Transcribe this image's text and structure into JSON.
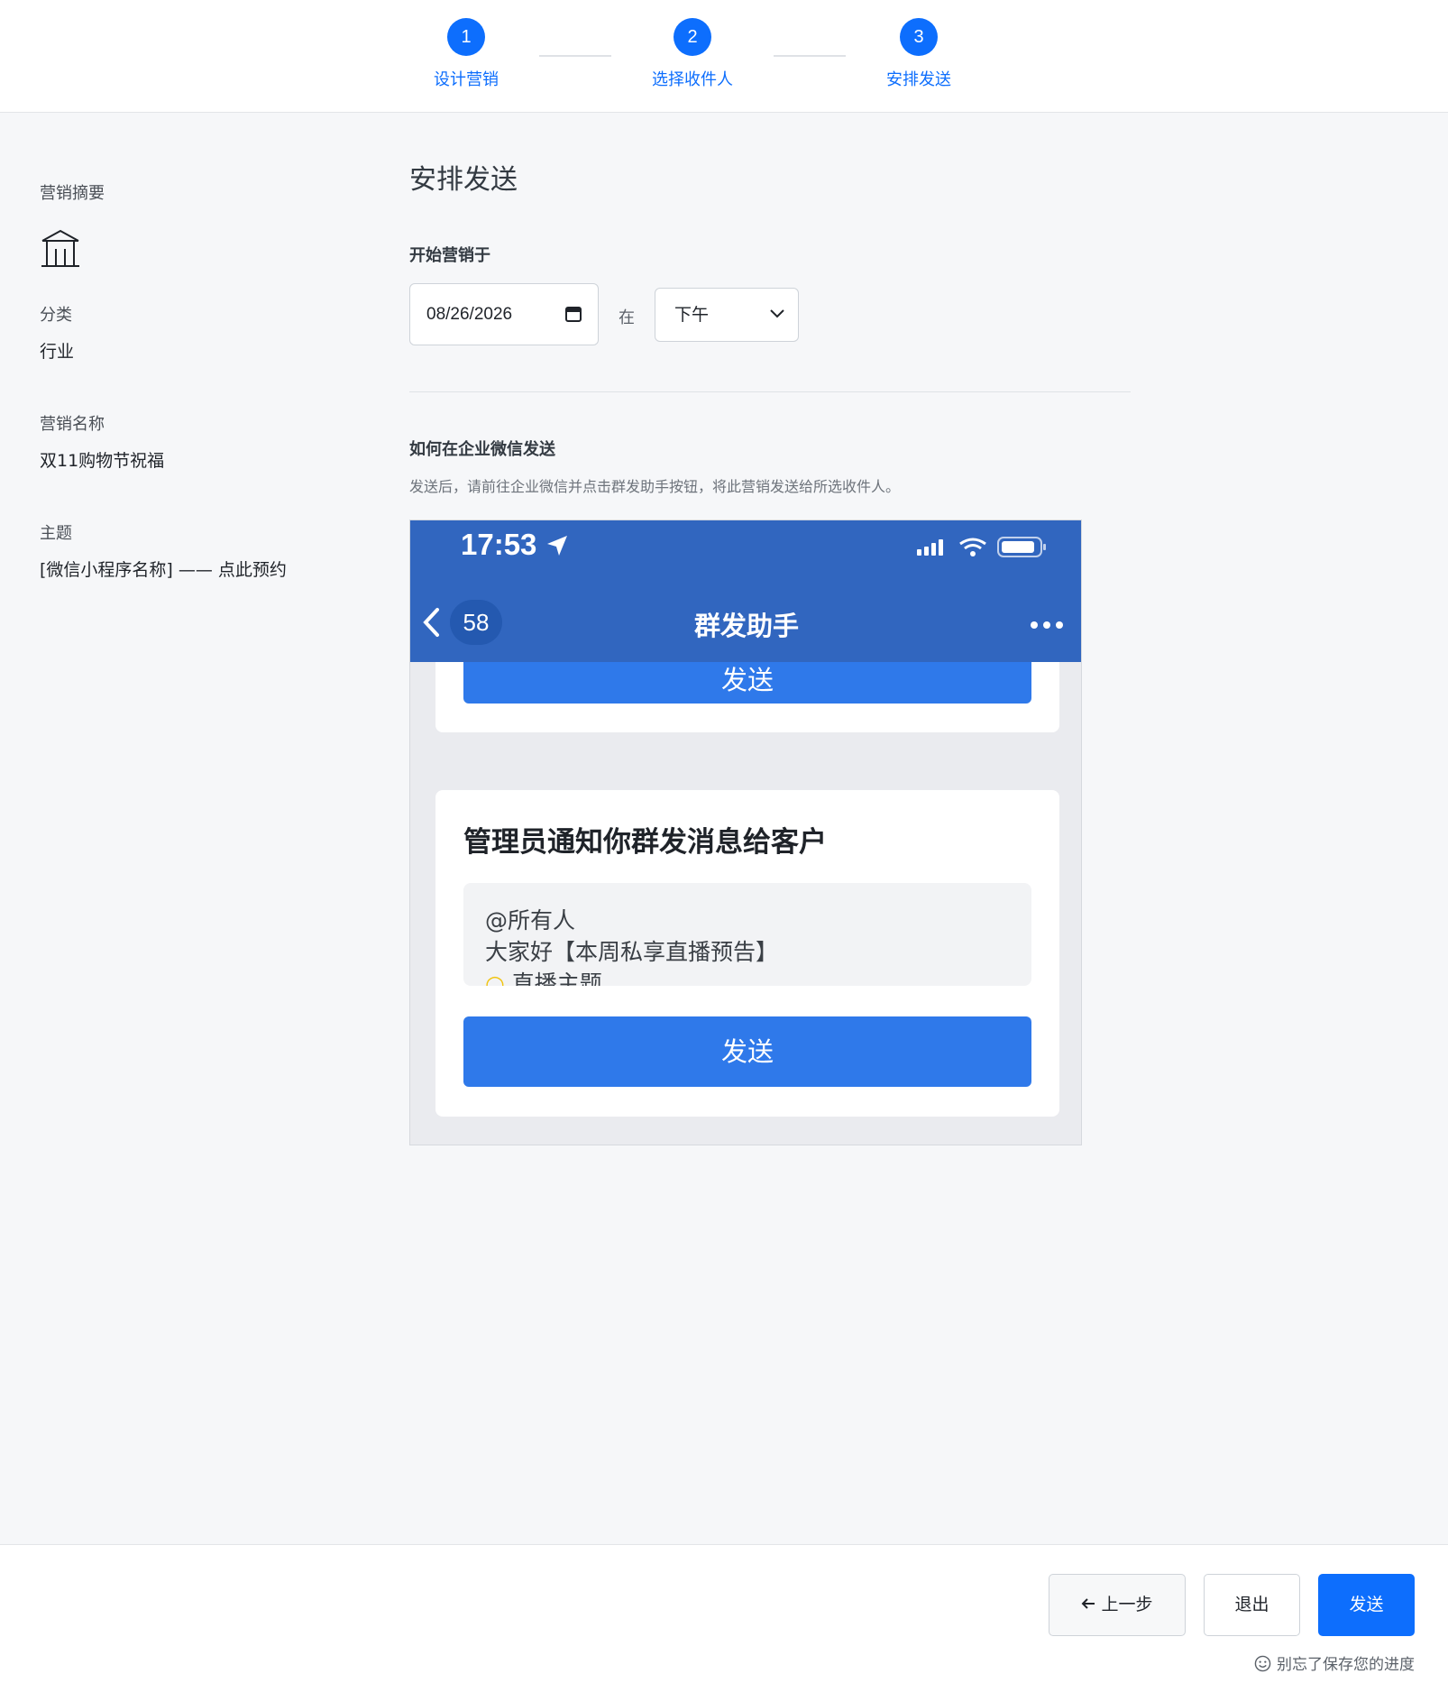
{
  "stepper": {
    "steps": [
      {
        "number": "1",
        "label": "设计营销"
      },
      {
        "number": "2",
        "label": "选择收件人"
      },
      {
        "number": "3",
        "label": "安排发送"
      }
    ]
  },
  "summary": {
    "heading": "营销摘要",
    "icon": "building-icon",
    "category_label": "分类",
    "category_value": "行业",
    "name_label": "营销名称",
    "name_value": "双11购物节祝福",
    "subject_label": "主题",
    "subject_value": "[微信小程序名称] —— 点此预约"
  },
  "schedule": {
    "title": "安排发送",
    "start_label": "开始营销于",
    "date_value": "08/26/2026",
    "at_label": "在",
    "time_value": "下午"
  },
  "how_to": {
    "title": "如何在企业微信发送",
    "description": "发送后，请前往企业微信并点击群发助手按钮，将此营销发送给所选收件人。"
  },
  "phone_preview": {
    "status_time": "17:53",
    "badge_count": "58",
    "nav_title": "群发助手",
    "top_send_label": "发送",
    "card_title": "管理员通知你群发消息给客户",
    "message_lines": [
      "@所有人",
      "大家好【本周私享直播预告】",
      "直播主题"
    ],
    "card_send_label": "发送"
  },
  "footer": {
    "prev_label": "上一步",
    "exit_label": "退出",
    "send_label": "发送",
    "save_hint": "别忘了保存您的进度"
  },
  "colors": {
    "primary": "#0d6efd",
    "wechat_header": "#3166bf",
    "wechat_button": "#2f79ea"
  }
}
